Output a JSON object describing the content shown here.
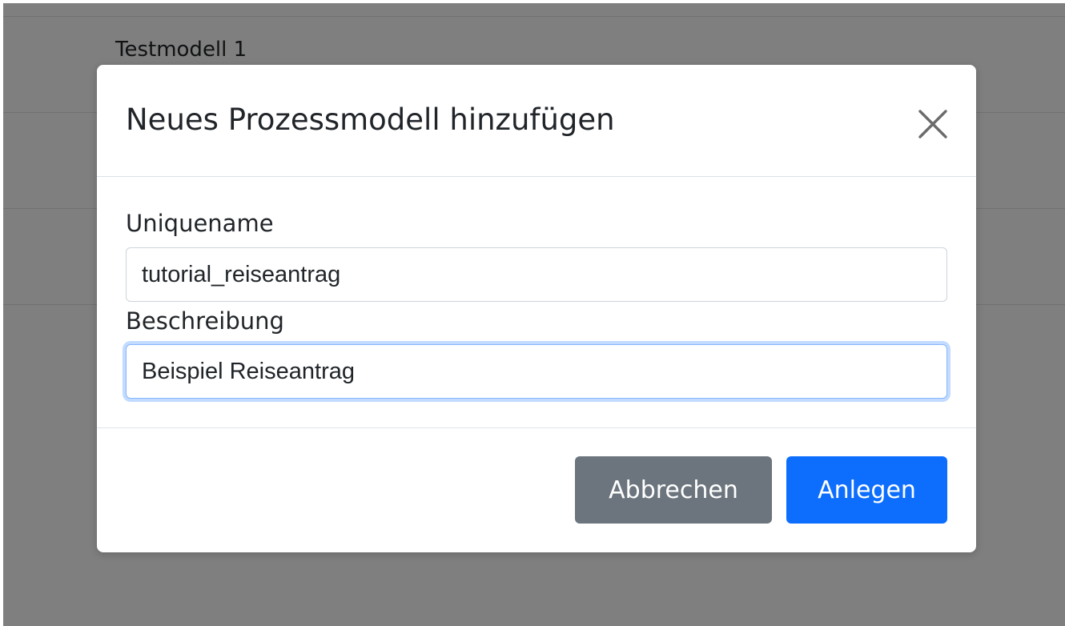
{
  "background_page": {
    "rows": [
      {
        "title": "Testmodell 1"
      }
    ]
  },
  "modal": {
    "title": "Neues Prozessmodell hinzufügen",
    "close_icon": "close-icon",
    "fields": {
      "uniquename": {
        "label": "Uniquename",
        "value": "tutorial_reiseantrag"
      },
      "beschreibung": {
        "label": "Beschreibung",
        "value": "Beispiel Reiseantrag"
      }
    },
    "buttons": {
      "cancel": "Abbrechen",
      "create": "Anlegen"
    }
  },
  "colors": {
    "primary": "#0d6efd",
    "secondary": "#6c757d",
    "backdrop": "rgba(0,0,0,0.5)",
    "focus_ring": "#86b7fe"
  }
}
